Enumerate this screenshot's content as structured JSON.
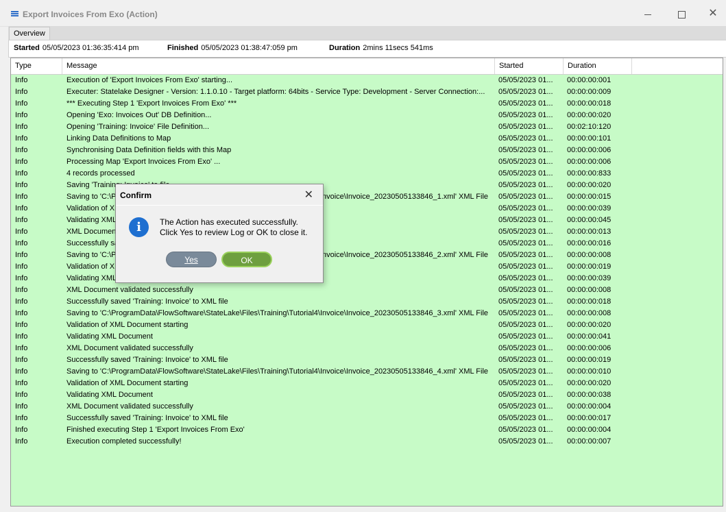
{
  "window": {
    "title": "Export Invoices From Exo (Action)",
    "icon": "menu-lines-icon",
    "controls": {
      "minimize": "minimize-icon",
      "maximize": "maximize-icon",
      "close": "✕"
    }
  },
  "tabs": [
    {
      "label": "Overview"
    }
  ],
  "summary": {
    "started_label": "Started",
    "started_value": "05/05/2023 01:36:35:414 pm",
    "finished_label": "Finished",
    "finished_value": "05/05/2023 01:38:47:059 pm",
    "duration_label": "Duration",
    "duration_value": "2mins 11secs 541ms"
  },
  "grid": {
    "background_color": "#c7fbc7",
    "columns": {
      "type": "Type",
      "message": "Message",
      "started": "Started",
      "duration": "Duration"
    },
    "rows": [
      {
        "type": "Info",
        "message": "Execution of 'Export Invoices From Exo' starting...",
        "started": "05/05/2023 01...",
        "duration": "00:00:00:001"
      },
      {
        "type": "Info",
        "message": "Executer: Statelake Designer - Version: 1.1.0.10 - Target platform:  64bits - Service Type: Development - Server Connection:...",
        "started": "05/05/2023 01...",
        "duration": "00:00:00:009"
      },
      {
        "type": "Info",
        "message": "*** Executing Step 1 'Export Invoices From Exo' ***",
        "started": "05/05/2023 01...",
        "duration": "00:00:00:018"
      },
      {
        "type": "Info",
        "message": "Opening 'Exo: Invoices Out' DB Definition...",
        "started": "05/05/2023 01...",
        "duration": "00:00:00:020"
      },
      {
        "type": "Info",
        "message": "Opening 'Training: Invoice' File Definition...",
        "started": "05/05/2023 01...",
        "duration": "00:02:10:120"
      },
      {
        "type": "Info",
        "message": "Linking Data Definitions to Map",
        "started": "05/05/2023 01...",
        "duration": "00:00:00:101"
      },
      {
        "type": "Info",
        "message": "Synchronising Data Definition fields with this Map",
        "started": "05/05/2023 01...",
        "duration": "00:00:00:006"
      },
      {
        "type": "Info",
        "message": "Processing Map 'Export Invoices From Exo' ...",
        "started": "05/05/2023 01...",
        "duration": "00:00:00:006"
      },
      {
        "type": "Info",
        "message": "4 records processed",
        "started": "05/05/2023 01...",
        "duration": "00:00:00:833"
      },
      {
        "type": "Info",
        "message": "Saving 'Training: Invoice' to file",
        "started": "05/05/2023 01...",
        "duration": "00:00:00:020"
      },
      {
        "type": "Info",
        "message": "Saving to 'C:\\ProgramData\\FlowSoftware\\StateLake\\Files\\Training\\Tutorial4\\Invoice\\Invoice_20230505133846_1.xml' XML File",
        "started": "05/05/2023 01...",
        "duration": "00:00:00:015"
      },
      {
        "type": "Info",
        "message": "Validation of XML Document starting",
        "started": "05/05/2023 01...",
        "duration": "00:00:00:039"
      },
      {
        "type": "Info",
        "message": "Validating XML Document",
        "started": "05/05/2023 01...",
        "duration": "00:00:00:045"
      },
      {
        "type": "Info",
        "message": "XML Document validated successfully",
        "started": "05/05/2023 01...",
        "duration": "00:00:00:013"
      },
      {
        "type": "Info",
        "message": "Successfully saved 'Training: Invoice' to XML file",
        "started": "05/05/2023 01...",
        "duration": "00:00:00:016"
      },
      {
        "type": "Info",
        "message": "Saving to 'C:\\ProgramData\\FlowSoftware\\StateLake\\Files\\Training\\Tutorial4\\Invoice\\Invoice_20230505133846_2.xml' XML File",
        "started": "05/05/2023 01...",
        "duration": "00:00:00:008"
      },
      {
        "type": "Info",
        "message": "Validation of XML Document starting",
        "started": "05/05/2023 01...",
        "duration": "00:00:00:019"
      },
      {
        "type": "Info",
        "message": "Validating XML Document",
        "started": "05/05/2023 01...",
        "duration": "00:00:00:039"
      },
      {
        "type": "Info",
        "message": "XML Document validated successfully",
        "started": "05/05/2023 01...",
        "duration": "00:00:00:008"
      },
      {
        "type": "Info",
        "message": "Successfully saved 'Training: Invoice' to XML file",
        "started": "05/05/2023 01...",
        "duration": "00:00:00:018"
      },
      {
        "type": "Info",
        "message": "Saving to 'C:\\ProgramData\\FlowSoftware\\StateLake\\Files\\Training\\Tutorial4\\Invoice\\Invoice_20230505133846_3.xml' XML File",
        "started": "05/05/2023 01...",
        "duration": "00:00:00:008"
      },
      {
        "type": "Info",
        "message": "Validation of XML Document starting",
        "started": "05/05/2023 01...",
        "duration": "00:00:00:020"
      },
      {
        "type": "Info",
        "message": "Validating XML Document",
        "started": "05/05/2023 01...",
        "duration": "00:00:00:041"
      },
      {
        "type": "Info",
        "message": "XML Document validated successfully",
        "started": "05/05/2023 01...",
        "duration": "00:00:00:006"
      },
      {
        "type": "Info",
        "message": "Successfully saved 'Training: Invoice' to XML file",
        "started": "05/05/2023 01...",
        "duration": "00:00:00:019"
      },
      {
        "type": "Info",
        "message": "Saving to 'C:\\ProgramData\\FlowSoftware\\StateLake\\Files\\Training\\Tutorial4\\Invoice\\Invoice_20230505133846_4.xml' XML File",
        "started": "05/05/2023 01...",
        "duration": "00:00:00:010"
      },
      {
        "type": "Info",
        "message": "Validation of XML Document starting",
        "started": "05/05/2023 01...",
        "duration": "00:00:00:020"
      },
      {
        "type": "Info",
        "message": "Validating XML Document",
        "started": "05/05/2023 01...",
        "duration": "00:00:00:038"
      },
      {
        "type": "Info",
        "message": "XML Document validated successfully",
        "started": "05/05/2023 01...",
        "duration": "00:00:00:004"
      },
      {
        "type": "Info",
        "message": "Successfully saved 'Training: Invoice' to XML file",
        "started": "05/05/2023 01...",
        "duration": "00:00:00:017"
      },
      {
        "type": "Info",
        "message": "Finished executing Step 1 'Export Invoices From Exo'",
        "started": "05/05/2023 01...",
        "duration": "00:00:00:004"
      },
      {
        "type": "Info",
        "message": "Execution completed successfully!",
        "started": "05/05/2023 01...",
        "duration": "00:00:00:007"
      }
    ]
  },
  "dialog": {
    "title": "Confirm",
    "close_glyph": "✕",
    "icon": "info-icon",
    "icon_glyph": "i",
    "message_line1": "The Action has executed successfully.",
    "message_line2": "Click Yes to review Log or OK to close it.",
    "yes_label": "Yes",
    "ok_label": "OK"
  }
}
